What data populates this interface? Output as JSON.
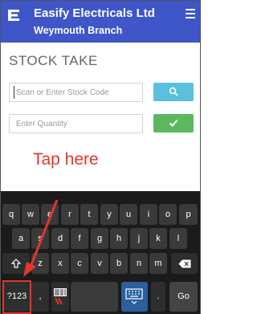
{
  "header": {
    "app_name": "Easify Electricals Ltd",
    "branch": "Weymouth Branch",
    "logo_icon": "easify-e-logo-icon",
    "menu_icon": "hamburger-menu-icon",
    "color": "#3f56c8"
  },
  "page": {
    "title": "STOCK TAKE"
  },
  "stock_input": {
    "placeholder": "Scan or Enter Stock Code",
    "value": ""
  },
  "quantity_input": {
    "placeholder": "Enter Quantity",
    "value": ""
  },
  "buttons": {
    "search_icon": "search-icon",
    "search_color": "#5bc0de",
    "confirm_icon": "checkmark-icon",
    "confirm_color": "#5cb85c"
  },
  "annotation": {
    "text": "Tap here",
    "color": "#e4352e"
  },
  "keyboard": {
    "row1": [
      "q",
      "w",
      "e",
      "r",
      "t",
      "y",
      "u",
      "i",
      "o",
      "p"
    ],
    "row2": [
      "a",
      "s",
      "d",
      "f",
      "g",
      "h",
      "j",
      "k",
      "l"
    ],
    "row3": [
      "z",
      "x",
      "c",
      "v",
      "b",
      "n",
      "m"
    ],
    "shift_icon": "shift-icon",
    "backspace_icon": "backspace-icon",
    "symbols_label": "?123",
    "comma_label": ",",
    "period_label": ".",
    "go_label": "Go",
    "barcode_icon": "barcode-scanner-icon",
    "keyboard_icon": "keyboard-switch-icon"
  }
}
